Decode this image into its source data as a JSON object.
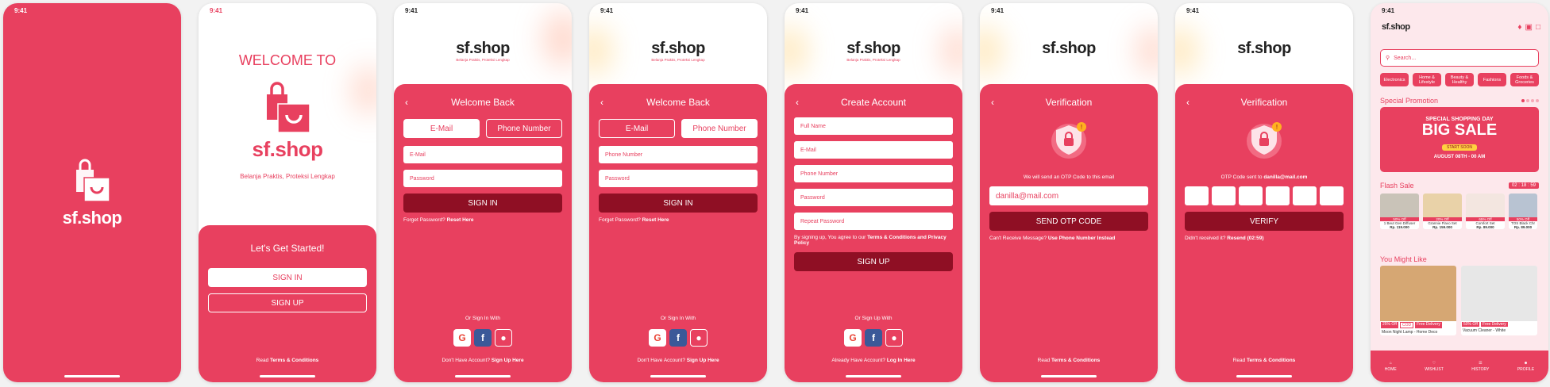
{
  "status_time": "9:41",
  "brand": {
    "name": "sf.shop",
    "tagline": "Belanja Praktis, Proteksi Lengkap",
    "tagline_small": "Belanja Praktis, Proteksi Lengkap"
  },
  "screen_welcome": {
    "welcome_to": "WELCOME TO",
    "started": "Let's Get Started!",
    "sign_in": "SIGN IN",
    "sign_up": "SIGN UP",
    "read": "Read",
    "terms": "Terms & Conditions"
  },
  "screen_signin_email": {
    "title": "Welcome Back",
    "tab_email": "E-Mail",
    "tab_phone": "Phone Number",
    "email_placeholder": "E-Mail",
    "password_placeholder": "Password",
    "sign_in": "SIGN IN",
    "forget": "Forget Password?",
    "reset": "Reset Here",
    "or_sign_in": "Or Sign In With",
    "no_account": "Don't Have Account?",
    "sign_up_here": "Sign Up Here"
  },
  "screen_signin_phone": {
    "title": "Welcome Back",
    "tab_email": "E-Mail",
    "tab_phone": "Phone Number",
    "phone_placeholder": "Phone Number",
    "password_placeholder": "Password",
    "sign_in": "SIGN IN",
    "forget": "Forget Password?",
    "reset": "Reset Here",
    "or_sign_in": "Or Sign In With",
    "no_account": "Don't Have Account?",
    "sign_up_here": "Sign Up Here"
  },
  "screen_create": {
    "title": "Create Account",
    "full_name": "Full Name",
    "email": "E-Mail",
    "phone": "Phone Number",
    "password": "Password",
    "repeat": "Repeat Password",
    "agree": "By signing up, You agree to our",
    "terms_privacy": "Terms & Conditions and Privacy Policy",
    "sign_up": "SIGN UP",
    "or_sign_up": "Or Sign Up With",
    "already": "Already Have Account?",
    "login_here": "Log In Here"
  },
  "screen_verify_email": {
    "title": "Verification",
    "message": "We will send an OTP Code to this email",
    "email_value": "danilla@mail.com",
    "send": "SEND OTP CODE",
    "cant_receive": "Can't Receive Message?",
    "use_phone": "Use Phone Number Instead",
    "read": "Read",
    "terms": "Terms & Conditions"
  },
  "screen_verify_otp": {
    "title": "Verification",
    "sent_to": "OTP Code sent to",
    "email": "danilla@mail.com",
    "verify": "VERIFY",
    "didnt": "Didn't received it?",
    "resend": "Resend (02:59)",
    "read": "Read",
    "terms": "Terms & Conditions"
  },
  "screen_home": {
    "search_placeholder": "Search...",
    "categories": [
      "Electronics",
      "Home & Lifestyle",
      "Beauty & Healthy",
      "Fashions",
      "Foods & Groceries"
    ],
    "special_promotion": "Special Promotion",
    "banner": {
      "line1": "SPECIAL SHOPPING DAY",
      "line2": "BIG SALE",
      "start": "START SOON",
      "date": "AUGUST 08TH - 00 AM"
    },
    "flash_sale": "Flash Sale",
    "timer": "02 : 18 : 59",
    "flash_items": [
      {
        "discount": "50% Off",
        "name": "1 Beut Gen Diffuser",
        "price": "Rp. 119.000"
      },
      {
        "discount": "20% Off",
        "name": "Grannie Flavo Set",
        "price": "Rp. 159.000"
      },
      {
        "discount": "65% Off",
        "name": "Comfort Set",
        "price": "Rp. 89.000"
      },
      {
        "discount": "50% Off",
        "name": "TOS Black Chr",
        "price": "Rp. 89.000"
      }
    ],
    "you_might_like": "You Might Like",
    "like_items": [
      {
        "discount": "25% Off",
        "cod": "COD",
        "delivery": "Free Delivery",
        "name": "Moon Night Lamp - Home Deco"
      },
      {
        "discount": "50% Off",
        "delivery": "Free Delivery",
        "name": "Vacuum Cleaner - White"
      }
    ],
    "nav": [
      "HOME",
      "WISHLIST",
      "HISTORY",
      "PROFILE"
    ]
  }
}
